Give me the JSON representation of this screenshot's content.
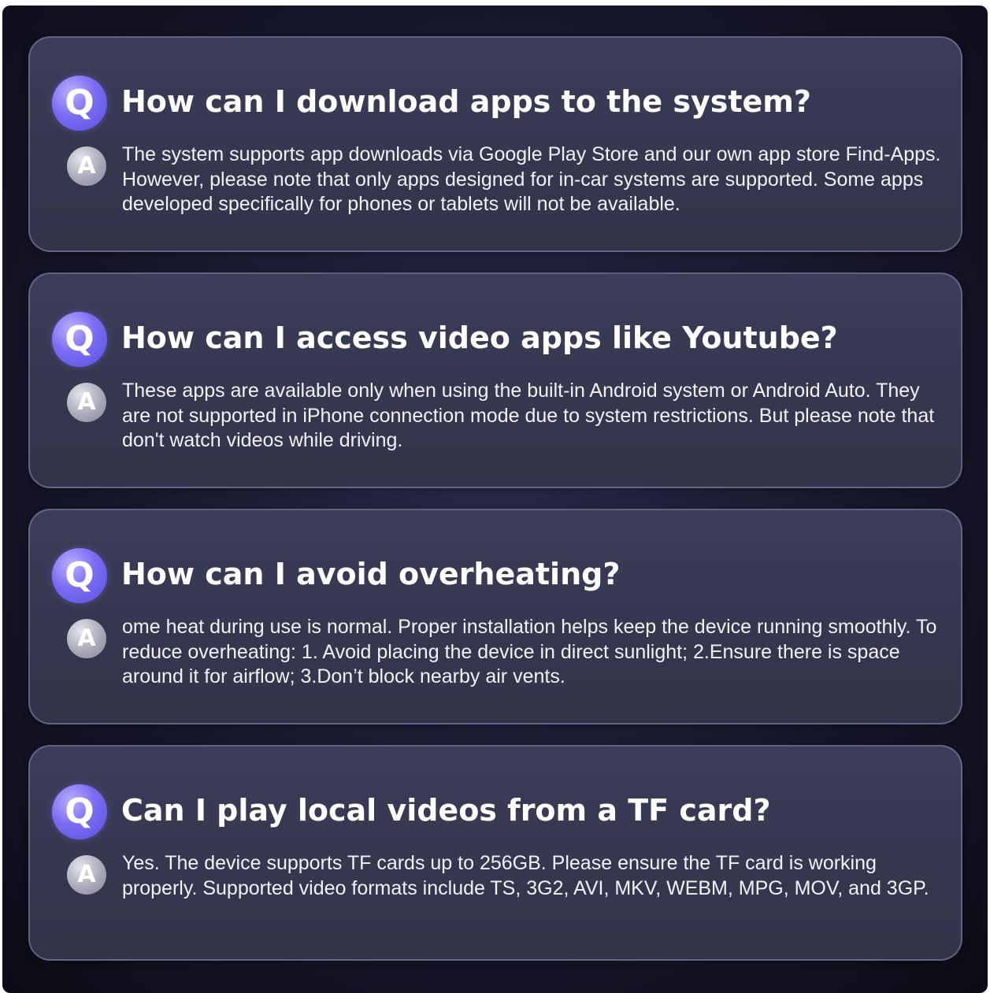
{
  "faq": {
    "q_badge": "Q",
    "a_badge": "A",
    "items": [
      {
        "question": "How can I download apps to the system?",
        "answer": "The system supports app downloads via Google Play Store and our own app store Find-Apps. However, please note that only apps designed for in-car systems are supported. Some apps developed specifically for phones or tablets will not be available."
      },
      {
        "question": "How can I access video apps like Youtube?",
        "answer": "These apps are available only when using the built-in Android system or Android Auto. They are not supported in iPhone connection mode due to system restrictions. But please note that don't watch videos while driving."
      },
      {
        "question": "How can I avoid overheating?",
        "answer": "ome heat during use is normal. Proper installation helps keep the device running smoothly. To reduce overheating: 1. Avoid placing the device in direct sunlight; 2.Ensure there is space around it for airflow; 3.Don’t block nearby air vents."
      },
      {
        "question": "Can I play local videos from a TF card?",
        "answer": "Yes. The device supports TF cards up to 256GB. Please ensure the TF card is working properly. Supported video formats include TS, 3G2, AVI, MKV, WEBM, MPG, MOV, and 3GP."
      }
    ]
  }
}
